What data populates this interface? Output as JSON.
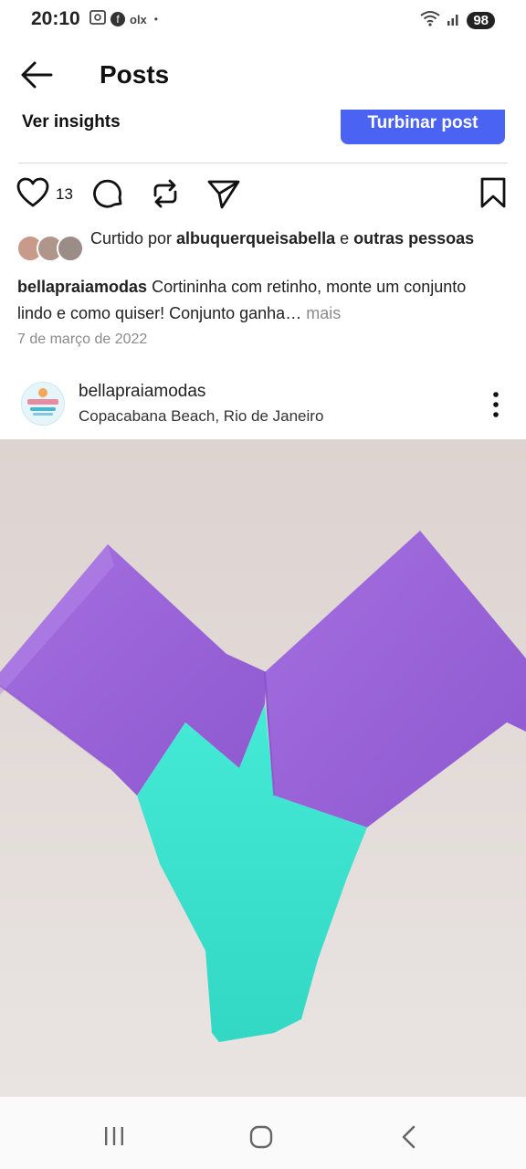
{
  "status_bar": {
    "time": "20:10",
    "notification_icons": [
      "screenshot-icon",
      "facebook-icon",
      "olx-icon",
      "dot-icon"
    ],
    "olx_text": "olx",
    "dot": "•",
    "battery": "98"
  },
  "header": {
    "title": "Posts"
  },
  "toolbar": {
    "insights_label": "Ver insights",
    "boost_label": "Turbinar post"
  },
  "actions": {
    "like_count": "13"
  },
  "likes": {
    "prefix": "Curtido por ",
    "user": "albuquerqueisabella",
    "connector": " e ",
    "others": "outras pessoas"
  },
  "caption": {
    "username": "bellapraiamodas",
    "text": " Cortininha com retinho, monte um conjunto lindo e como quiser! Conjunto ganha…",
    "more": "mais"
  },
  "date": "7 de março de 2022",
  "post": {
    "username": "bellapraiamodas",
    "location": "Copacabana Beach, Rio de Janeiro"
  },
  "colors": {
    "accent": "#4a63f2",
    "image_background": "#dcd2d0",
    "purple": "#a069dd",
    "teal": "#3ee3cf"
  }
}
